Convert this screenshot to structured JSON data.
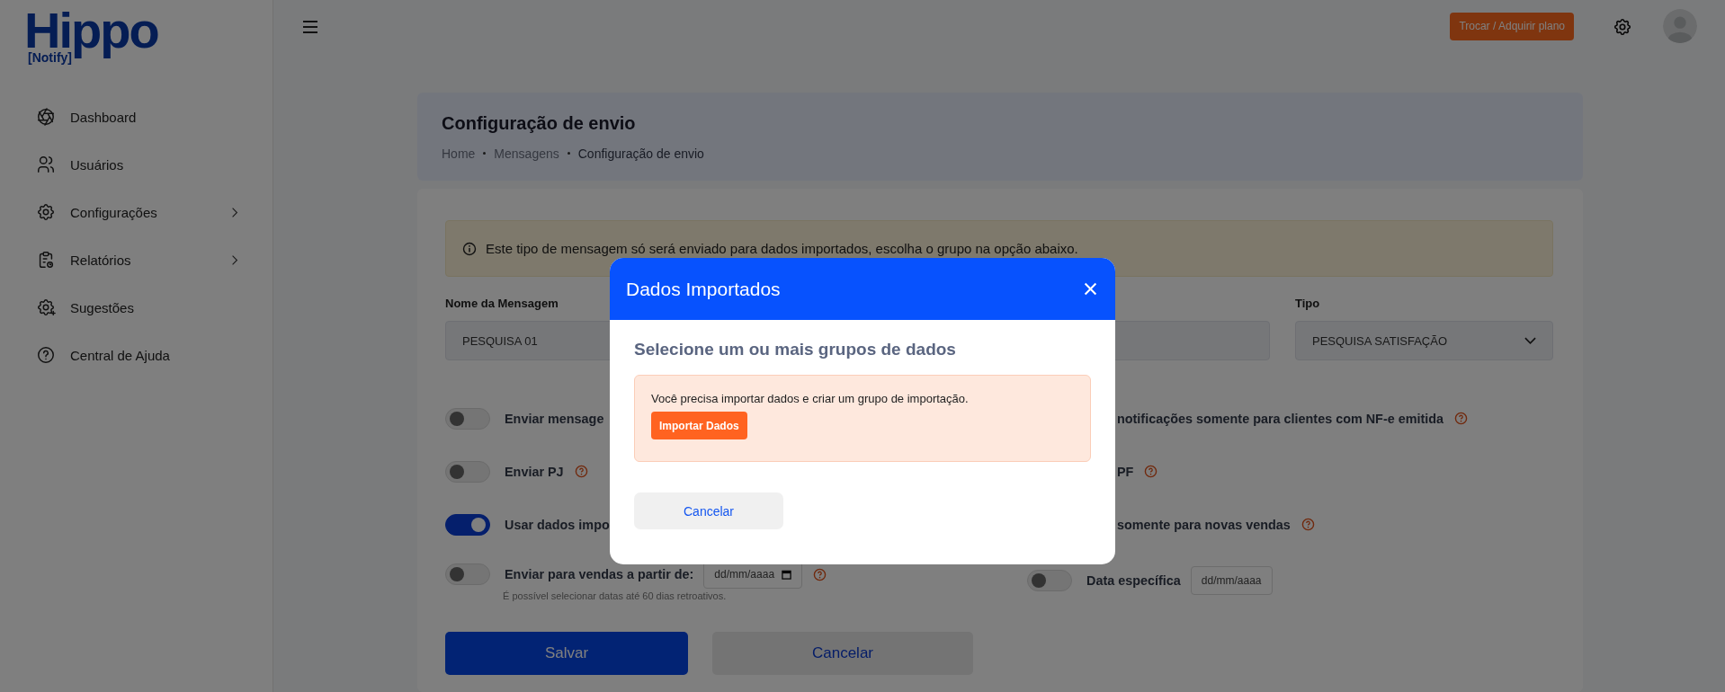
{
  "logo": {
    "title": "Hippo",
    "tagline": "[Notify]"
  },
  "sidebar": {
    "items": [
      {
        "label": "Dashboard",
        "expandable": false
      },
      {
        "label": "Usuários",
        "expandable": false
      },
      {
        "label": "Configurações",
        "expandable": true
      },
      {
        "label": "Relatórios",
        "expandable": true
      },
      {
        "label": "Sugestões",
        "expandable": false
      },
      {
        "label": "Central de Ajuda",
        "expandable": false
      }
    ]
  },
  "header": {
    "plan_button": "Trocar / Adquirir plano"
  },
  "page": {
    "title": "Configuração de envio",
    "breadcrumb": [
      "Home",
      "Mensagens",
      "Configuração de envio"
    ]
  },
  "form": {
    "notice": "Este tipo de mensagem só será enviado para dados importados, escolha o grupo na opção abaixo.",
    "fields": [
      {
        "kind": "text",
        "label": "Nome da Mensagem",
        "value": "PESQUISA 01"
      },
      {
        "kind": "text"
      },
      {
        "kind": "select",
        "label": "Tipo",
        "value": "PESQUISA SATISFAÇÃO"
      }
    ],
    "rows": [
      {
        "left": {
          "label": "Enviar mensage",
          "on": false
        },
        "right": {
          "label": "notificações somente para clientes com NF-e emitida",
          "help": true
        }
      },
      {
        "left": {
          "label": "Enviar PJ",
          "on": false,
          "help": true
        },
        "right": {
          "label": "PF",
          "help": true
        }
      },
      {
        "left": {
          "label": "Usar dados impo",
          "on": true
        },
        "right": {
          "label": "somente para novas vendas",
          "help": true
        }
      },
      {
        "left": {
          "label": "Enviar para vendas a partir de:",
          "on": false,
          "help": true,
          "date_placeholder": "dd/mm/aaaa",
          "calendar_icon": true,
          "hint": "É possível selecionar datas até 60 dias retroativos."
        },
        "right": {
          "label": "Data específica",
          "on": false,
          "date_placeholder": "dd/mm/aaaa"
        }
      }
    ],
    "buttons": [
      {
        "label": "Salvar",
        "kind": "primary"
      },
      {
        "label": "Cancelar",
        "kind": "secondary"
      }
    ]
  },
  "modal": {
    "title": "Dados Importados",
    "subtitle": "Selecione um ou mais grupos de dados",
    "message": "Você precisa importar dados e criar um grupo de importação.",
    "action": "Importar Dados",
    "cancel": "Cancelar"
  }
}
